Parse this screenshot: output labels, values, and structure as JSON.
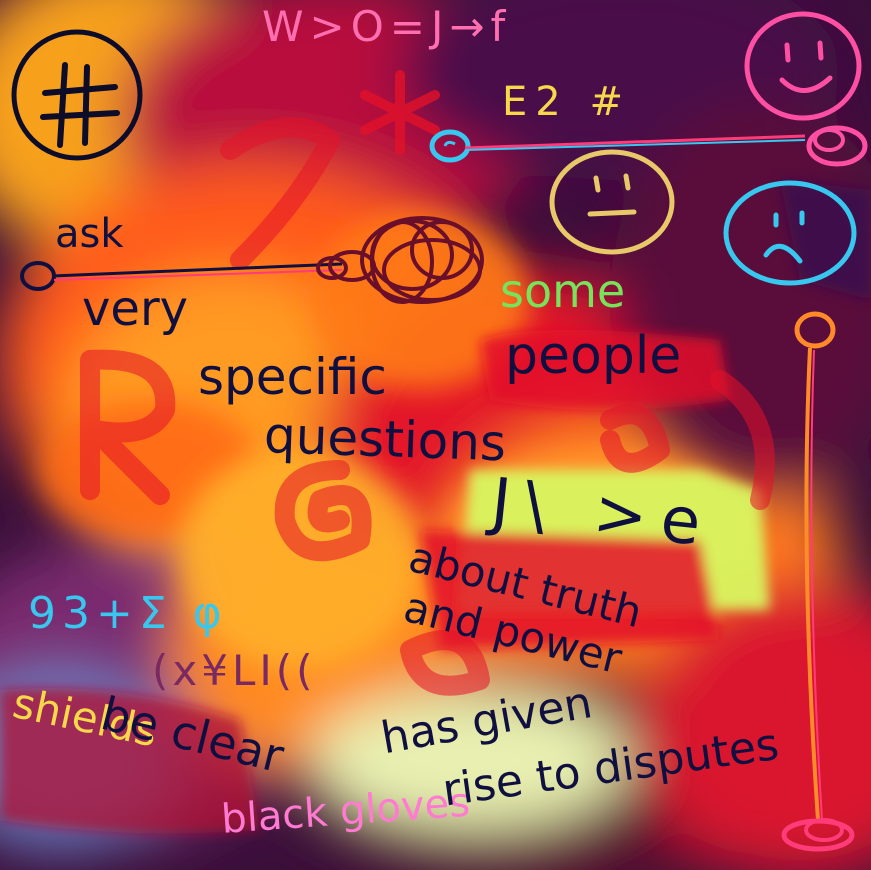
{
  "colors": {
    "background_dark": "#3a0f3a",
    "warm_orange": "#ff8a1c",
    "hot_red": "#e3122a",
    "lime": "#d8f560",
    "ink_navy": "#101040",
    "pink": "#ff4fa3",
    "cyan": "#38c7ee",
    "sand": "#e9c86a",
    "green": "#78e35a",
    "yellow": "#f6d84a",
    "blue": "#7bc3ff",
    "orange_line": "#ff8a2a"
  },
  "icons": [
    "hash-in-circle-icon",
    "smiley-face-icon",
    "neutral-face-icon",
    "sad-face-icon",
    "asterisk-icon",
    "scribble-icon"
  ],
  "texts": {
    "formula_top": "W>O=J→f",
    "e2": "E2 #",
    "ask": "ask",
    "very": "very",
    "specific": "specific",
    "questions": "questions",
    "some": "some",
    "people": "people",
    "jbe": "J\\ >e",
    "about_truth": "about truth",
    "and_power": "and power",
    "greek": "93+Σ φ",
    "misc": "(x¥LI((",
    "shields": "shields",
    "be_clear": "be clear",
    "black_gloves": "black gloves",
    "has_given": "has given",
    "rise_to_disputes": "rise to disputes"
  }
}
